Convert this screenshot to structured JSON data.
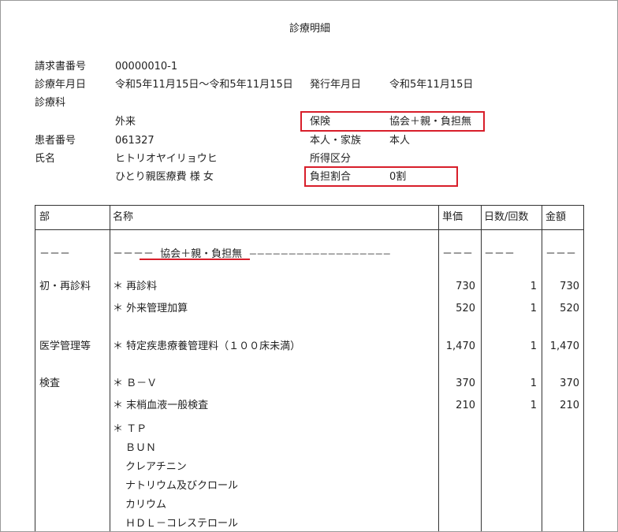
{
  "title": "診療明細",
  "header": {
    "invoice_label": "請求書番号",
    "invoice_value": "00000010-1",
    "date_label": "診療年月日",
    "date_value": "令和5年11月15日～令和5年11月15日",
    "issue_label": "発行年月日",
    "issue_value": "令和5年11月15日",
    "dept_label": "診療科",
    "dept_value": "外来",
    "insurance_label": "保険",
    "insurance_value": "協会＋親・負担無",
    "patient_no_label": "患者番号",
    "patient_no_value": "061327",
    "relation_label": "本人・家族",
    "relation_value": "本人",
    "name_label": "氏名",
    "name_kana": "ヒトリオヤイリョウヒ",
    "income_label": "所得区分",
    "name_value": "ひとり親医療費 様 女",
    "burden_label": "負担割合",
    "burden_value": "0割"
  },
  "table": {
    "headers": [
      "部",
      "名称",
      "単価",
      "日数/回数",
      "金額"
    ],
    "dash_row": {
      "section": "－－－",
      "name_prefix": "－－－－",
      "name_insurance": "協会＋親・負担無",
      "name_suffix": "－－－－－－－－－－－－－－－－－－",
      "unit": "－－－",
      "days": "－－－",
      "amount": "－－－"
    },
    "rows": [
      {
        "section": "初・再診料",
        "name": "＊ 再診料",
        "unit": "730",
        "days": "1",
        "amount": "730"
      },
      {
        "section": "",
        "name": "＊ 外来管理加算",
        "unit": "520",
        "days": "1",
        "amount": "520"
      },
      {
        "section": "医学管理等",
        "name": "＊ 特定疾患療養管理料（１００床未満）",
        "unit": "1,470",
        "days": "1",
        "amount": "1,470"
      },
      {
        "section": "検査",
        "name": "＊ Ｂ－Ｖ",
        "unit": "370",
        "days": "1",
        "amount": "370"
      },
      {
        "section": "",
        "name": "＊ 末梢血液一般検査",
        "unit": "210",
        "days": "1",
        "amount": "210"
      },
      {
        "section": "",
        "name": "＊ ＴＰ",
        "unit": "",
        "days": "",
        "amount": ""
      },
      {
        "section": "",
        "name": "ＢＵＮ",
        "unit": "",
        "days": "",
        "amount": ""
      },
      {
        "section": "",
        "name": "クレアチニン",
        "unit": "",
        "days": "",
        "amount": ""
      },
      {
        "section": "",
        "name": "ナトリウム及びクロール",
        "unit": "",
        "days": "",
        "amount": ""
      },
      {
        "section": "",
        "name": "カリウム",
        "unit": "",
        "days": "",
        "amount": ""
      },
      {
        "section": "",
        "name": "ＨＤＬ－コレステロール",
        "unit": "",
        "days": "",
        "amount": ""
      }
    ]
  },
  "colors": {
    "highlight": "#d81e2a",
    "border": "#333333"
  }
}
